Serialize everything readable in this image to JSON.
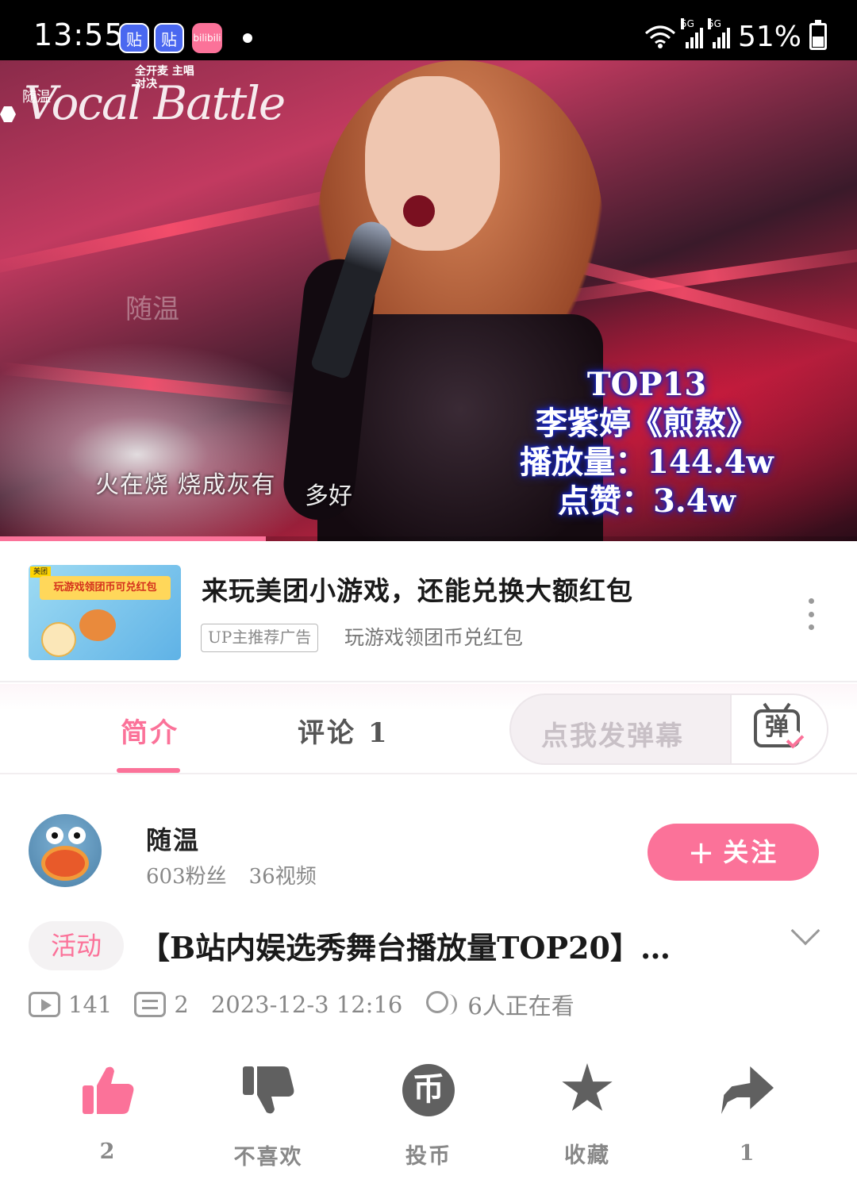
{
  "status_bar": {
    "time": "13:55",
    "app_icons": [
      "贴",
      "贴",
      "bilibili"
    ],
    "network_1": "5G",
    "network_2": "5G",
    "battery": "51%"
  },
  "video": {
    "logo_text": "Vocal Battle",
    "logo_brand": "bilibili",
    "logo_sub": "全开麦 主唱对决",
    "uploader_mark": "随温",
    "watermark": "随温",
    "subtitle_line": "火在烧 烧成灰有",
    "subtitle_tail": "多好",
    "overlay": {
      "rank": "TOP13",
      "song": "李紫婷《煎熬》",
      "plays": "播放量：144.4w",
      "likes": "点赞：3.4w"
    },
    "progress_fraction": 0.31
  },
  "ad": {
    "thumb_brand": "美团",
    "thumb_banner": "玩游戏领团币可兑红包",
    "title": "来玩美团小游戏，还能兑换大额红包",
    "tag": "UP主推荐广告",
    "subtitle": "玩游戏领团币兑红包"
  },
  "tabs": {
    "intro": "简介",
    "comments": "评论 1",
    "danmu_placeholder": "点我发弹幕",
    "danmu_icon_text": "弹"
  },
  "uploader": {
    "name": "随温",
    "fans": "603粉丝",
    "videos": "36视频",
    "follow_label": "关注",
    "follow_plus": "+"
  },
  "video_info": {
    "tag": "活动",
    "title": "【B站内娱选秀舞台播放量TOP20】…",
    "views": "141",
    "danmaku": "2",
    "date": "2023-12-3 12:16",
    "watching": "6人正在看"
  },
  "actions": {
    "like": "2",
    "dislike": "不喜欢",
    "coin": "投币",
    "coin_symbol": "币",
    "favorite": "收藏",
    "share": "1"
  },
  "colors": {
    "accent": "#fb7299",
    "icon_gray": "#606060"
  }
}
